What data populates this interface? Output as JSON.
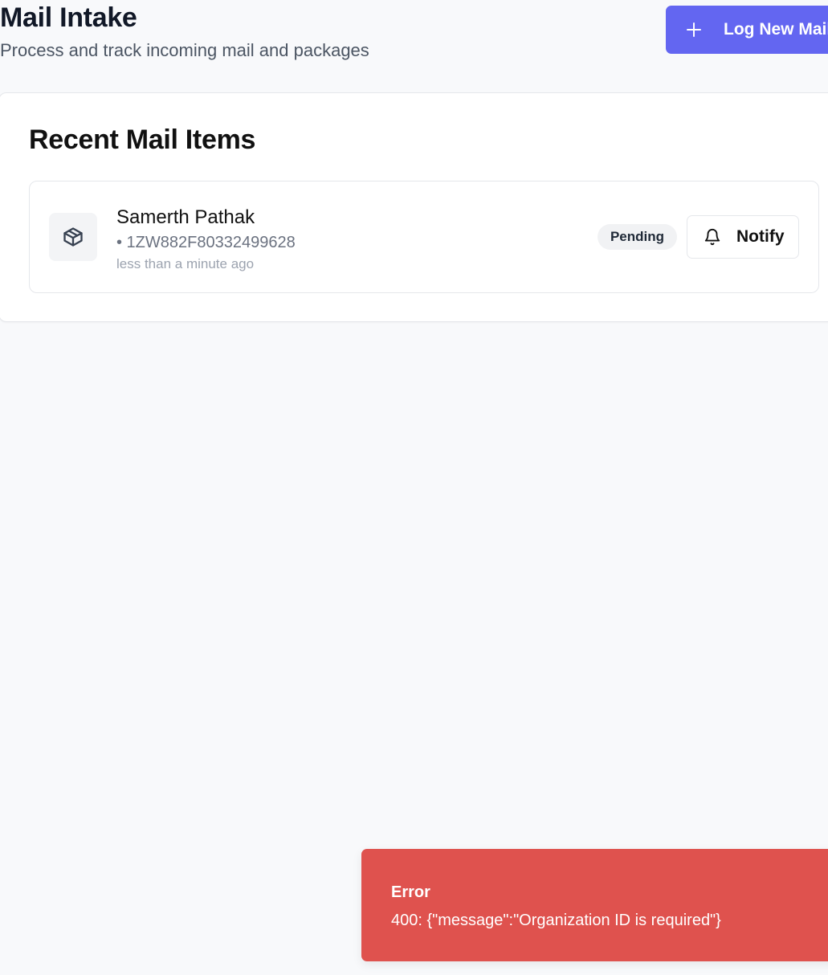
{
  "header": {
    "title": "Mail Intake",
    "subtitle": "Process and track incoming mail and packages",
    "log_button_label": "Log New Mail",
    "log_button_icon": "plus-icon"
  },
  "recent": {
    "title": "Recent Mail Items",
    "items": [
      {
        "icon": "package-icon",
        "recipient": "Samerth Pathak",
        "tracking": "• 1ZW882F80332499628",
        "time": "less than a minute ago",
        "status": "Pending",
        "notify_label": "Notify",
        "notify_icon": "bell-icon"
      }
    ]
  },
  "toast": {
    "title": "Error",
    "message": "400: {\"message\":\"Organization ID is required\"}",
    "color": "#df524e"
  },
  "colors": {
    "accent": "#6366f1",
    "background": "#f8f9fb",
    "error": "#df524e"
  }
}
